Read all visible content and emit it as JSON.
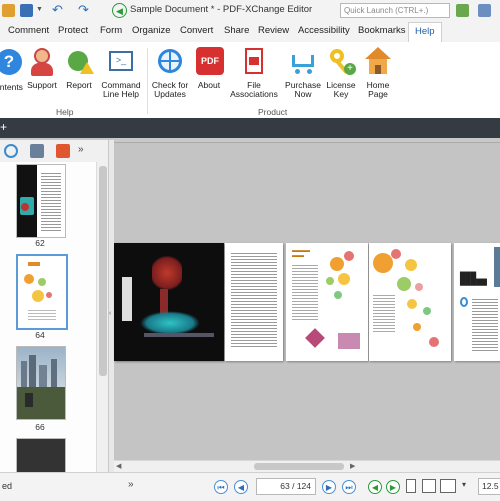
{
  "window": {
    "title": "Sample Document * - PDF-XChange Editor"
  },
  "quick_launch": {
    "placeholder": "Quick Launch (CTRL+.)"
  },
  "ribbon_tabs": [
    {
      "label": "Comment"
    },
    {
      "label": "Protect"
    },
    {
      "label": "Form"
    },
    {
      "label": "Organize"
    },
    {
      "label": "Convert"
    },
    {
      "label": "Share"
    },
    {
      "label": "Review"
    },
    {
      "label": "Accessibility"
    },
    {
      "label": "Bookmarks"
    },
    {
      "label": "Help",
      "active": true
    }
  ],
  "ribbon": {
    "groups": {
      "help": "Help",
      "product": "Product"
    },
    "buttons": [
      {
        "label1": "ontents",
        "label2": "",
        "icon": "help-question-icon"
      },
      {
        "label1": "Support",
        "label2": "",
        "icon": "support-agent-icon"
      },
      {
        "label1": "Report",
        "label2": "",
        "icon": "bug-report-icon"
      },
      {
        "label1": "Command",
        "label2": "Line Help",
        "icon": "command-line-icon"
      },
      {
        "label1": "Check for",
        "label2": "Updates",
        "icon": "globe-update-icon"
      },
      {
        "label1": "About",
        "label2": "",
        "icon": "pdf-about-icon"
      },
      {
        "label1": "File",
        "label2": "Associations",
        "icon": "file-association-icon"
      },
      {
        "label1": "Purchase",
        "label2": "Now",
        "icon": "cart-icon"
      },
      {
        "label1": "License",
        "label2": "Key",
        "icon": "license-key-icon"
      },
      {
        "label1": "Home",
        "label2": "Page",
        "icon": "home-icon"
      }
    ]
  },
  "strip": {
    "plus": "+"
  },
  "thumbnails": [
    {
      "page": "62"
    },
    {
      "page": "64",
      "selected": true
    },
    {
      "page": "66"
    }
  ],
  "status": {
    "page_value": "63",
    "page_total": "/ 124",
    "zoom": "12.5",
    "left_text": "ed"
  },
  "colors": {
    "accent": "#1f5fa8",
    "dark_strip": "#353b42",
    "selection": "#5d9bd6"
  }
}
